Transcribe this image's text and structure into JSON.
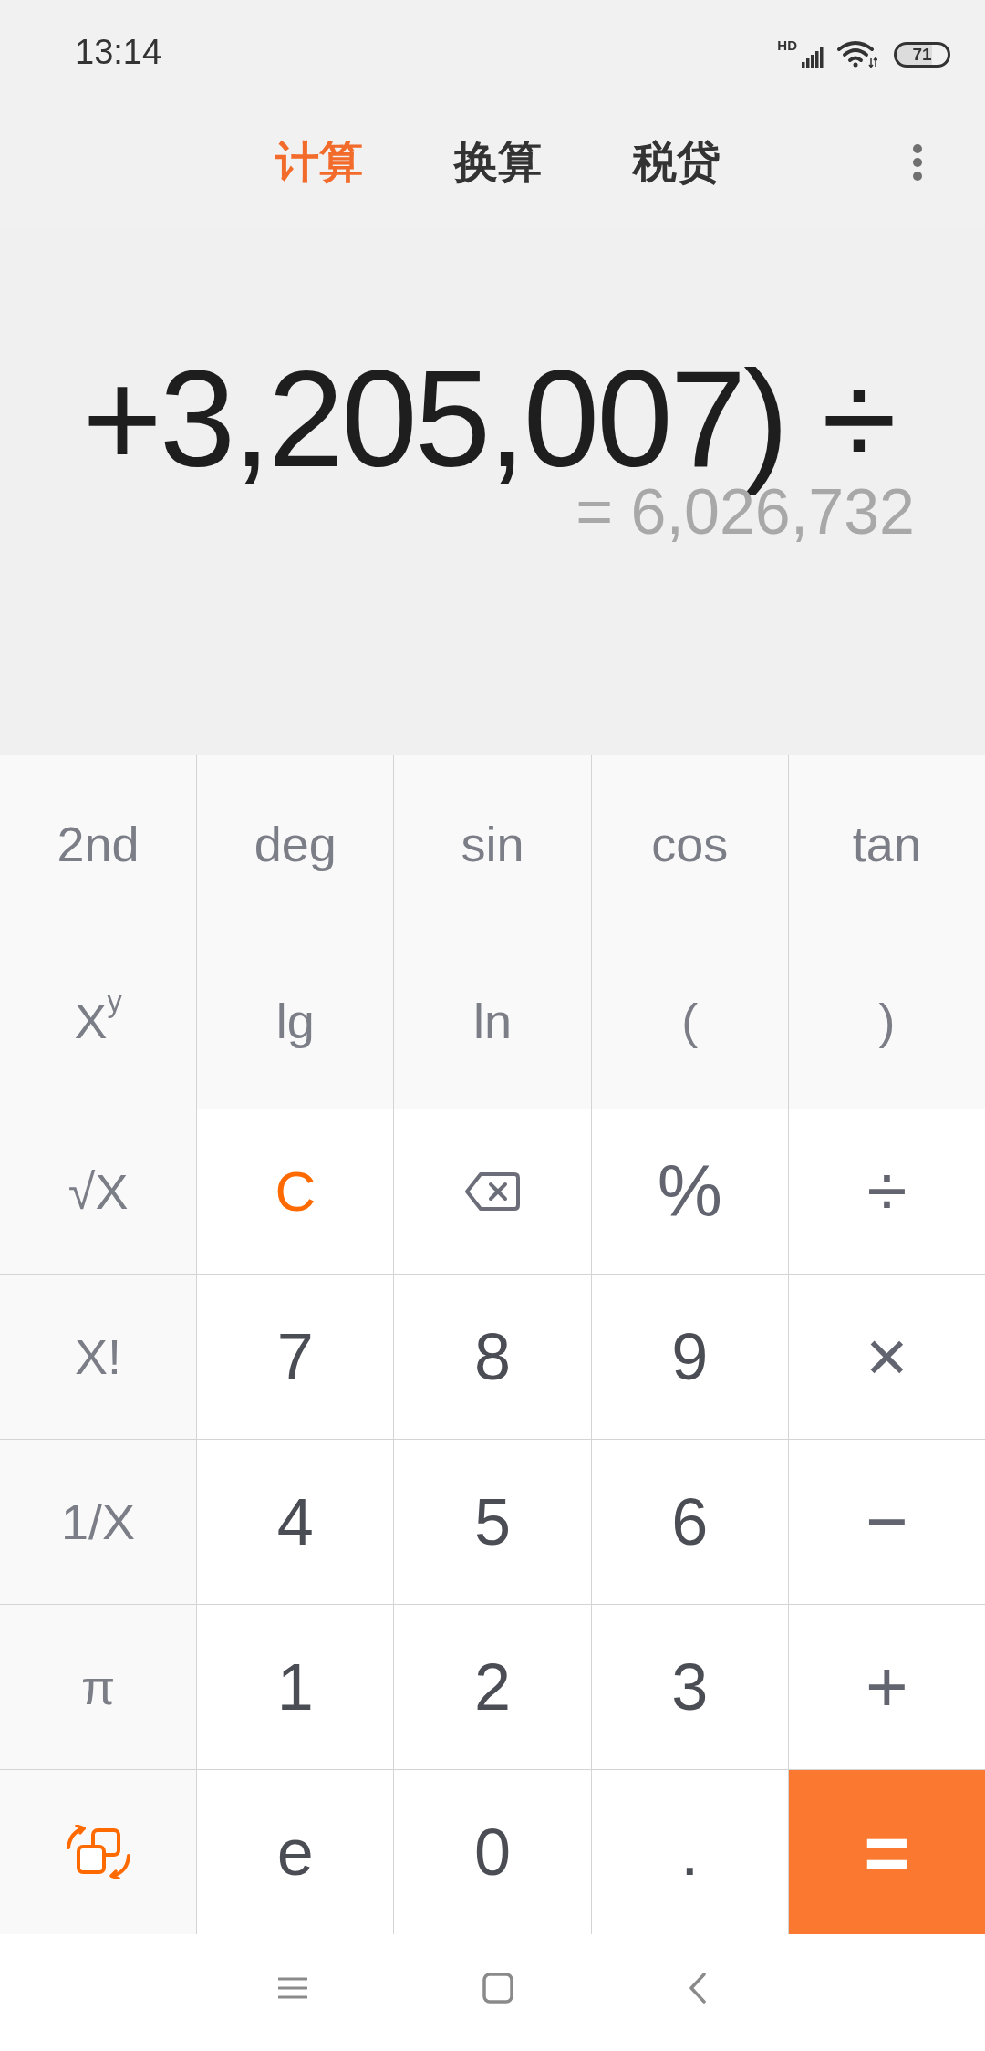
{
  "status_bar": {
    "time": "13:14",
    "network_type": "HD",
    "battery": "71"
  },
  "tabs": [
    {
      "label": "计算",
      "selected": true
    },
    {
      "label": "换算",
      "selected": false
    },
    {
      "label": "税贷",
      "selected": false
    }
  ],
  "display": {
    "expression": "+3,205,007) ÷",
    "result": "= 6,026,732"
  },
  "keypad": [
    [
      {
        "kind": "sci",
        "label": "2nd"
      },
      {
        "kind": "sci",
        "label": "deg"
      },
      {
        "kind": "sci",
        "label": "sin"
      },
      {
        "kind": "sci",
        "label": "cos"
      },
      {
        "kind": "sci",
        "label": "tan"
      }
    ],
    [
      {
        "kind": "sci",
        "label": "X$^{y}$"
      },
      {
        "kind": "sci",
        "label": "lg"
      },
      {
        "kind": "sci",
        "label": "ln"
      },
      {
        "kind": "sci",
        "label": "("
      },
      {
        "kind": "sci",
        "label": ")"
      }
    ],
    [
      {
        "kind": "sci",
        "label": "√X"
      },
      {
        "kind": "clear",
        "label": "C"
      },
      {
        "kind": "backspace"
      },
      {
        "kind": "operator",
        "label": "%"
      },
      {
        "kind": "operator",
        "label": "÷"
      }
    ],
    [
      {
        "kind": "sci",
        "label": "X!"
      },
      {
        "kind": "digit",
        "label": "7"
      },
      {
        "kind": "digit",
        "label": "8"
      },
      {
        "kind": "digit",
        "label": "9"
      },
      {
        "kind": "operator",
        "label": "×"
      }
    ],
    [
      {
        "kind": "sci",
        "label": "1/X"
      },
      {
        "kind": "digit",
        "label": "4"
      },
      {
        "kind": "digit",
        "label": "5"
      },
      {
        "kind": "digit",
        "label": "6"
      },
      {
        "kind": "operator",
        "label": "−"
      }
    ],
    [
      {
        "kind": "sci",
        "label": "π"
      },
      {
        "kind": "digit",
        "label": "1"
      },
      {
        "kind": "digit",
        "label": "2"
      },
      {
        "kind": "digit",
        "label": "3"
      },
      {
        "kind": "operator",
        "label": "+"
      }
    ],
    [
      {
        "kind": "switch"
      },
      {
        "kind": "digit",
        "label": "e"
      },
      {
        "kind": "digit",
        "label": "0"
      },
      {
        "kind": "digit",
        "label": "."
      },
      {
        "kind": "equals",
        "label": "="
      }
    ]
  ]
}
